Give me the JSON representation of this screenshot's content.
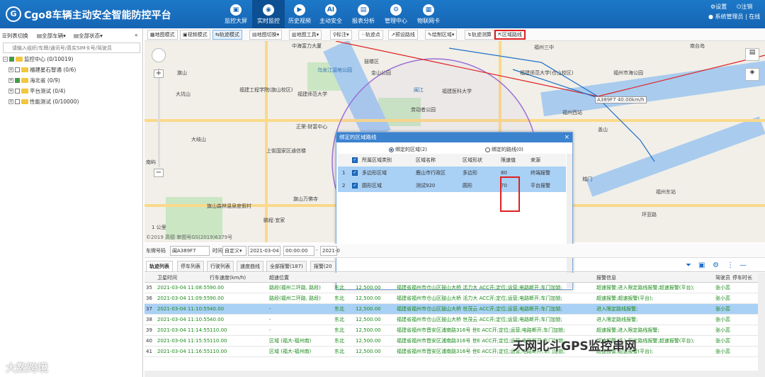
{
  "app": {
    "title": "Cgo8车辆主动安全智能防控平台",
    "logo": "G",
    "settings": "设置",
    "logout": "注销",
    "user": "系统管理员 | 在线"
  },
  "nav": [
    {
      "label": "监控大屏",
      "icon": "monitor-icon"
    },
    {
      "label": "实时监控",
      "icon": "realtime-icon"
    },
    {
      "label": "历史视频",
      "icon": "video-icon"
    },
    {
      "label": "主动安全",
      "icon": "ai-icon"
    },
    {
      "label": "报表分析",
      "icon": "report-icon"
    },
    {
      "label": "管理中心",
      "icon": "gear-icon"
    },
    {
      "label": "物联网卡",
      "icon": "card-icon"
    }
  ],
  "left": {
    "tools": [
      "列表切换",
      "全部车辆",
      "全部状态"
    ],
    "search_placeholder": "请输入组织/车牌/通讯号/真实SIM卡号/驾驶员",
    "tree": [
      {
        "label": "监控中心 (0/10019)"
      },
      {
        "label": "福建星石智通 (0/6)"
      },
      {
        "label": "海北省 (0/9)"
      },
      {
        "label": "平台测试 (0/4)"
      },
      {
        "label": "性能测试 (0/10000)"
      }
    ]
  },
  "toolbar": [
    "地图模式",
    "视频模式",
    "轨迹模式",
    "地图切换",
    "地图工具",
    "标注",
    "轨迹点",
    "预设路线",
    "绘制区域",
    "轨迹测算",
    "区域路线"
  ],
  "map": {
    "labels": [
      "中海富力大厦",
      "鼓楼区",
      "乌龙江湿地公园",
      "闽江",
      "金山公园",
      "福建师范大学(仓山校区)",
      "福州市海公园",
      "大坑山",
      "福建工程学院(旗山校区)",
      "福建师范大学",
      "劳动者公园",
      "福建医科大学",
      "正荣·财富中心",
      "上街国家区通信楼",
      "旗山万佛寺",
      "旗山森林温泉度假村",
      "鹏程·宜家",
      "旗山",
      "大岐山",
      "福州三中",
      "南台岛",
      "福州西站",
      "A389F7 40.00km/h",
      "盖山",
      "城门",
      "福州东站",
      "环亚路",
      "南屿"
    ],
    "scale": "1 公里",
    "copyright": "©2019 高德 审图号GS(2019)6379号"
  },
  "dialog": {
    "title": "绑定的区域路线",
    "radio_area": "绑定的区域(2)",
    "radio_route": "绑定的路线(0)",
    "headers": [
      "所属区域类别",
      "区域名称",
      "区域形状",
      "限速值",
      "来源"
    ],
    "rows": [
      {
        "no": "1",
        "type": "多边形区域",
        "name": "鹿山市行政区",
        "shape": "多边形",
        "speed": "80",
        "source": "终端报警"
      },
      {
        "no": "2",
        "type": "圆形区域",
        "name": "测试920",
        "shape": "圆形",
        "speed": "70",
        "source": "平台报警"
      }
    ]
  },
  "filter": {
    "plate_label": "车牌号码",
    "plate": "闽A389F7",
    "time_label": "时间",
    "range": "自定义",
    "date1": "2021-03-04",
    "time1": "00:00:00",
    "date2": "2021-0"
  },
  "tabs": [
    "轨迹列表",
    "停车列表",
    "行驶列表",
    "速度曲线",
    "全部报警(187)",
    "报警(20"
  ],
  "grid": {
    "headers": [
      "卫星时间",
      "行车速度(km/h)",
      "超速位置",
      "",
      "",
      "",
      "报警信息",
      "驾驶员",
      "停车时长"
    ],
    "rows": [
      {
        "no": "35",
        "time": "2021-03-04 11:08:55",
        "speed": "90.00",
        "pos": "路段(福州二环路, 路段)",
        "dir": "东北",
        "mile": "12,500.00",
        "loc": "福建省福州市仓山区鼓山大桥 活力大 ACC开;定位;运营;电路断开;车门加锁;",
        "alarm": "超速报警;进入限定路线报警;超速报警(平台);",
        "driver": "张小蕊"
      },
      {
        "no": "36",
        "time": "2021-03-04 11:09:55",
        "speed": "90.00",
        "pos": "路段(福州二环路, 路段)",
        "dir": "东北",
        "mile": "12,500.00",
        "loc": "福建省福州市仓山区鼓山大桥 活力大 ACC开;定位;运营;电路断开;车门加锁;",
        "alarm": "超速报警;超速报警(平台);",
        "driver": "张小蕊"
      },
      {
        "no": "37",
        "time": "2021-03-04 11:10:55",
        "speed": "40.00",
        "pos": "-",
        "dir": "东北",
        "mile": "12,500.00",
        "loc": "福建省福州市仓山区鼓山大桥 世茂云 ACC开;定位;运营;电路断开;车门加锁;",
        "alarm": "进入限定路线报警;",
        "driver": "张小蕊"
      },
      {
        "no": "38",
        "time": "2021-03-04 11:10:55",
        "speed": "40.00",
        "pos": "-",
        "dir": "东北",
        "mile": "12,500.00",
        "loc": "福建省福州市仓山区鼓山大桥 世茂云 ACC开;定位;运营;电路断开;车门加锁;",
        "alarm": "进入限定路线报警;",
        "driver": "张小蕊"
      },
      {
        "no": "39",
        "time": "2021-03-04 11:14:55",
        "speed": "110.00",
        "pos": "-",
        "dir": "东北",
        "mile": "12,500.00",
        "loc": "福建省福州市晋安区浦南路316号 世E ACC开;定位;运营;电路断开;车门加锁;",
        "alarm": "超速报警;进入限定路线报警;",
        "driver": "张小蕊"
      },
      {
        "no": "40",
        "time": "2021-03-04 11:15:55",
        "speed": "110.00",
        "pos": "区域 (福大-福州南)",
        "dir": "东北",
        "mile": "12,500.00",
        "loc": "福建省福州市晋安区浦南路316号 世E ACC开;定位;运营;电路断开;车门加锁;",
        "alarm": "超速报警;进入限定路线报警;超速报警(平台);",
        "driver": "张小蕊"
      },
      {
        "no": "41",
        "time": "2021-03-04 11:16:55",
        "speed": "110.00",
        "pos": "区域 (福大-福州南)",
        "dir": "东北",
        "mile": "12,500.00",
        "loc": "福建省福州市晋安区浦南路316号 世E ACC开;定位;运营;电路断开;车门加锁;",
        "alarm": "超速报警;超速报警(平台);",
        "driver": "张小蕊"
      }
    ]
  },
  "watermark": {
    "left": "大数跨境",
    "right": "天网北斗GPS监控串网"
  },
  "colors": {
    "primary": "#1565b4",
    "selected": "#a9d0f5",
    "highlight": "#e02020"
  }
}
